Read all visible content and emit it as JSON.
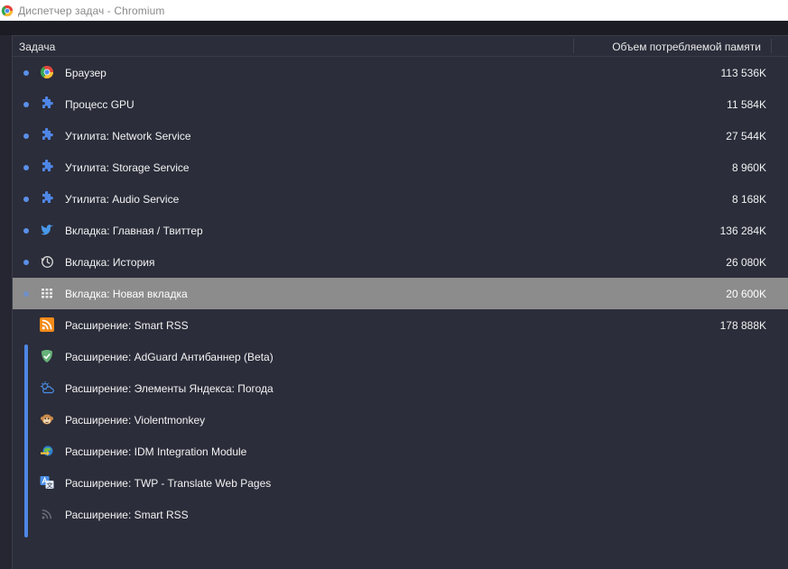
{
  "window": {
    "title": "Диспетчер задач - Chromium"
  },
  "header": {
    "task_column": "Задача",
    "memory_column": "Объем потребляемой памяти"
  },
  "rows": [
    {
      "name": "Браузер",
      "memory": "113 536K",
      "icon": "chromium-icon",
      "grouped": false,
      "selected": false
    },
    {
      "name": "Процесс GPU",
      "memory": "11 584K",
      "icon": "puzzle-icon",
      "grouped": false,
      "selected": false
    },
    {
      "name": "Утилита: Network Service",
      "memory": "27 544K",
      "icon": "puzzle-icon",
      "grouped": false,
      "selected": false
    },
    {
      "name": "Утилита: Storage Service",
      "memory": "8 960K",
      "icon": "puzzle-icon",
      "grouped": false,
      "selected": false
    },
    {
      "name": "Утилита: Audio Service",
      "memory": "8 168K",
      "icon": "puzzle-icon",
      "grouped": false,
      "selected": false
    },
    {
      "name": "Вкладка: Главная / Твиттер",
      "memory": "136 284K",
      "icon": "twitter-icon",
      "grouped": false,
      "selected": false
    },
    {
      "name": "Вкладка: История",
      "memory": "26 080K",
      "icon": "history-icon",
      "grouped": false,
      "selected": false
    },
    {
      "name": "Вкладка: Новая вкладка",
      "memory": "20 600K",
      "icon": "grid-icon",
      "grouped": false,
      "selected": true
    },
    {
      "name": "Расширение: Smart RSS",
      "memory": "178 888K",
      "icon": "rss-icon",
      "grouped": true,
      "selected": false
    },
    {
      "name": "Расширение: AdGuard Антибаннер (Beta)",
      "memory": "",
      "icon": "adguard-shield-icon",
      "grouped": true,
      "selected": false
    },
    {
      "name": "Расширение: Элементы Яндекса: Погода",
      "memory": "",
      "icon": "weather-icon",
      "grouped": true,
      "selected": false
    },
    {
      "name": "Расширение: Violentmonkey",
      "memory": "",
      "icon": "monkey-icon",
      "grouped": true,
      "selected": false
    },
    {
      "name": "Расширение: IDM Integration Module",
      "memory": "",
      "icon": "idm-icon",
      "grouped": true,
      "selected": false
    },
    {
      "name": "Расширение: TWP - Translate Web Pages",
      "memory": "",
      "icon": "translate-icon",
      "grouped": true,
      "selected": false
    },
    {
      "name": "Расширение: Smart RSS",
      "memory": "",
      "icon": "rss-gray-icon",
      "grouped": true,
      "selected": false
    }
  ],
  "colors": {
    "background": "#252631",
    "table": "#2b2d3a",
    "selected_row": "#8c8c8c",
    "dot": "#5b8fe8",
    "group_bar": "#4f86e6"
  }
}
